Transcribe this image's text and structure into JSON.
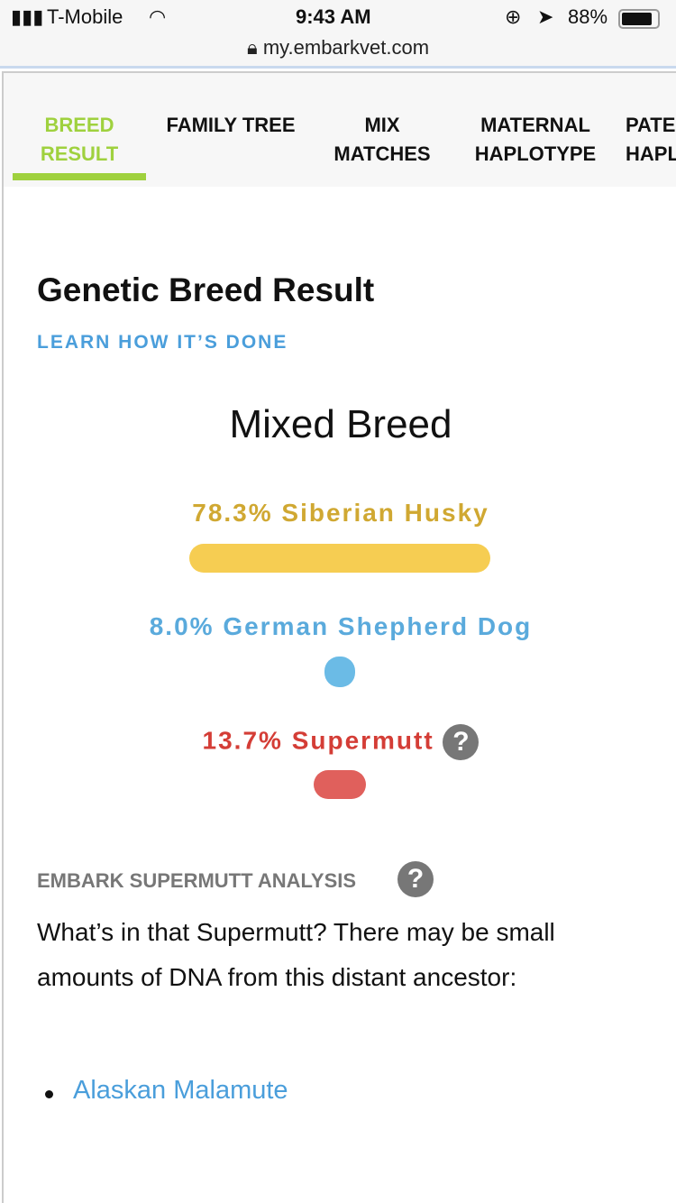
{
  "status_bar": {
    "carrier": "T-Mobile",
    "time": "9:43 AM",
    "battery": "88%",
    "url": "my.embarkvet.com"
  },
  "tabs": [
    {
      "label": "BREED\nRESULT",
      "active": true
    },
    {
      "label": "FAMILY TREE"
    },
    {
      "label": "MIX\nMATCHES"
    },
    {
      "label": "MATERNAL\nHAPLOTYPE"
    },
    {
      "label": "PATERNAL\nHAPLOTYPE"
    }
  ],
  "page": {
    "title": "Genetic Breed Result",
    "learn_link": "LEARN HOW IT’S DONE",
    "result": "Mixed Breed"
  },
  "breeds": [
    {
      "label": "78.3% Siberian Husky",
      "percent": 78.3,
      "color": "#f6cd52",
      "text_color": "#d0a832"
    },
    {
      "label": "8.0% German Shepherd Dog",
      "percent": 8.0,
      "color": "#6bbbe6",
      "text_color": "#5aaadc"
    },
    {
      "label": "13.7% Supermutt",
      "percent": 13.7,
      "color": "#e0605c",
      "text_color": "#d43d36"
    }
  ],
  "supermutt": {
    "heading": "EMBARK SUPERMUTT ANALYSIS",
    "text": "What’s in that Supermutt? There may be small amounts of DNA from this distant ancestor:",
    "ancestors": [
      "Alaskan Malamute"
    ]
  },
  "help_icon": "question-circle-icon"
}
